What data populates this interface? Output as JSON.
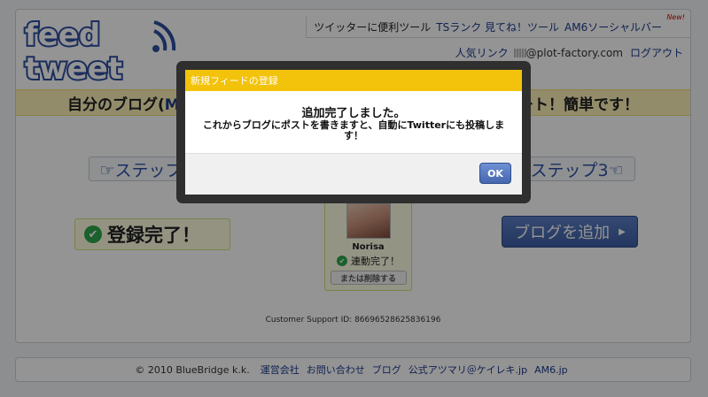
{
  "brand": {
    "logo_line1": "feed",
    "logo_line2": "tweet",
    "logo_color": "#2d4fa0"
  },
  "top_nav": {
    "items": [
      "ツイッターに便利ツール",
      "TSランク 見てね！ツール",
      "AM6ソーシャルバー"
    ],
    "new_badge": "New!"
  },
  "user_nav": {
    "popular_link": "人気リンク",
    "email": "@plot-factory.com",
    "logout": "ログアウト"
  },
  "headline": {
    "left": "自分のブログ(",
    "left_tail": "M",
    "right": "ート！簡単です！"
  },
  "steps": {
    "step1": "☞ステップ",
    "step3": "ステップ3☜"
  },
  "status": {
    "done_label": "登録完了！"
  },
  "profile": {
    "name": "Norisa",
    "status": "連動完了！",
    "unlink": "または削除する"
  },
  "actions": {
    "add_blog": "ブログを追加",
    "add_blog_arrow": "▶"
  },
  "support": {
    "text": "Customer Support ID: 86696528625836196"
  },
  "footer": {
    "copyright": "© 2010 BlueBridge k.k.",
    "links": [
      "運営会社",
      "お問い合わせ",
      "ブログ",
      "公式アツマリ＠ケイレキ.jp",
      "AM6.jp"
    ]
  },
  "dialog": {
    "title": "新規フィードの登録",
    "heading": "追加完了しました。",
    "message": "これからブログにポストを書きますと、自動にTwitterにも投稿します！",
    "ok_label": "OK"
  },
  "colors": {
    "accent_blue": "#1b3a8c",
    "dialog_title_bg": "#f3c20a",
    "success_green": "#2ea84a"
  }
}
